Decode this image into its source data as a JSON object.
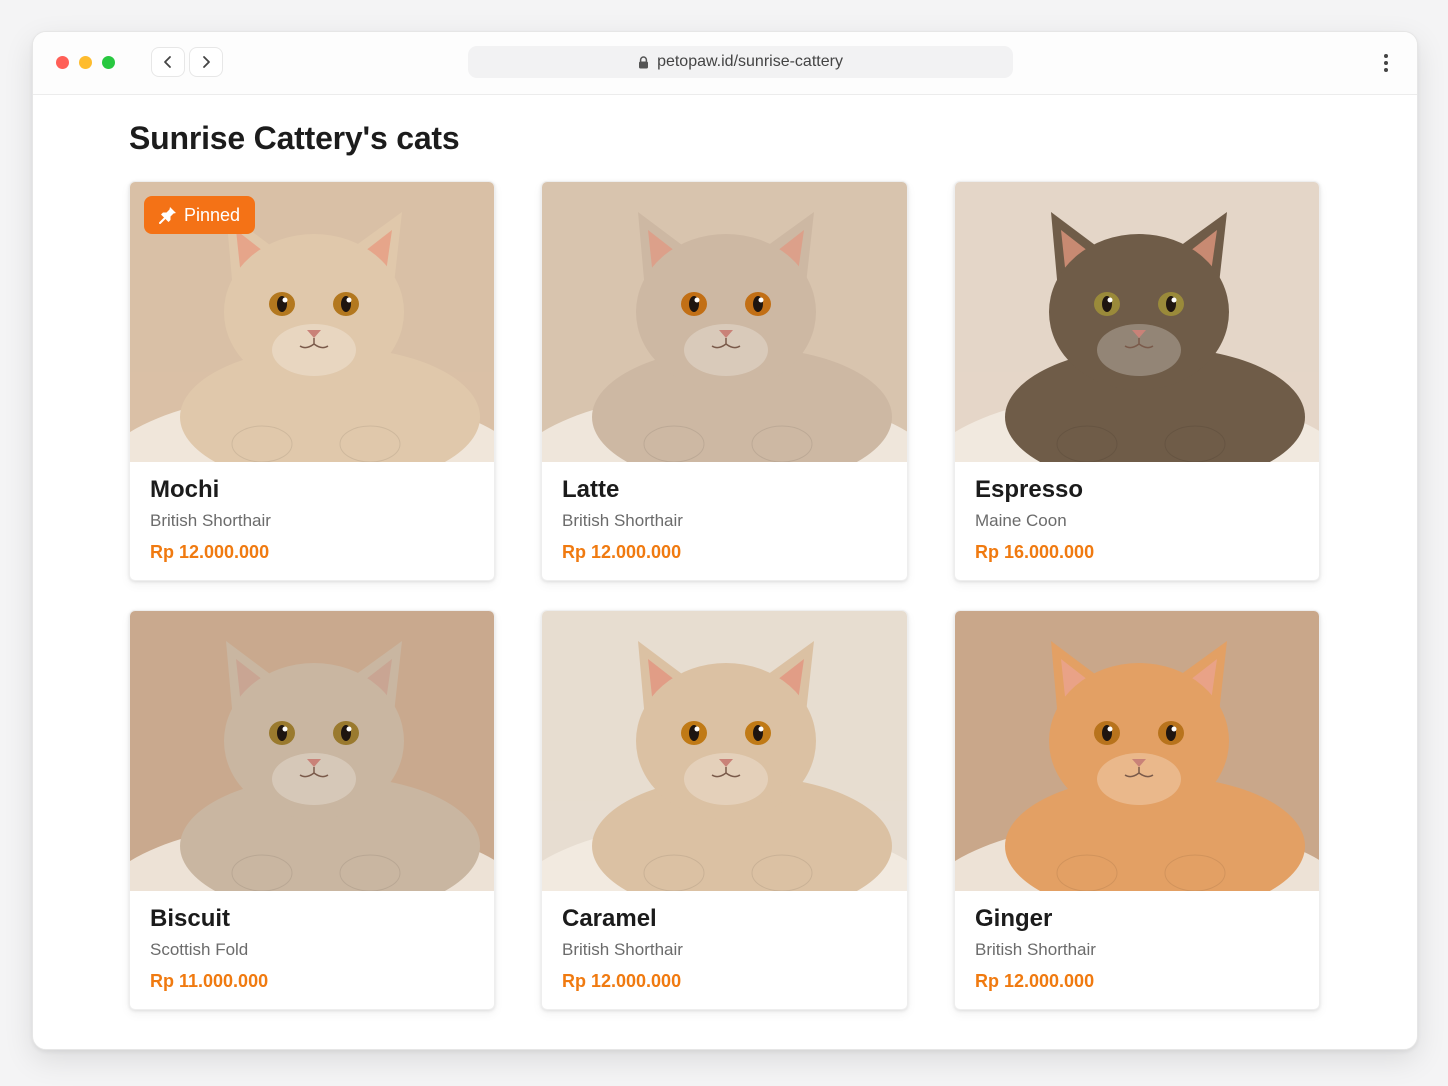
{
  "browser": {
    "url": "petopaw.id/sunrise-cattery",
    "icons": {
      "back": "chevron-left-icon",
      "forward": "chevron-right-icon",
      "lock": "lock-icon",
      "menu": "more-vertical-icon"
    }
  },
  "page": {
    "title": "Sunrise Cattery's cats"
  },
  "pinned_label": "Pinned",
  "cats": [
    {
      "name": "Mochi",
      "breed": "British Shorthair",
      "price": "Rp 12.000.000",
      "pinned": true,
      "fur": "#e0c8ab",
      "bg": "#d9c0a6",
      "ear": "#e6a58a",
      "eye": "#b3781f"
    },
    {
      "name": "Latte",
      "breed": "British Shorthair",
      "price": "Rp 12.000.000",
      "pinned": false,
      "fur": "#cdb8a3",
      "bg": "#d8c4ae",
      "ear": "#dca08a",
      "eye": "#c26f15"
    },
    {
      "name": "Espresso",
      "breed": "Maine Coon",
      "price": "Rp 16.000.000",
      "pinned": false,
      "fur": "#6f5c48",
      "bg": "#e4d6c8",
      "ear": "#c88a72",
      "eye": "#9a8a3a"
    },
    {
      "name": "Biscuit",
      "breed": "Scottish Fold",
      "price": "Rp 11.000.000",
      "pinned": false,
      "fur": "#c9b6a1",
      "bg": "#c9a98e",
      "ear": "#c9a593",
      "eye": "#9a7a2e"
    },
    {
      "name": "Caramel",
      "breed": "British Shorthair",
      "price": "Rp 12.000.000",
      "pinned": false,
      "fur": "#dbc1a3",
      "bg": "#e7ddd0",
      "ear": "#e19d86",
      "eye": "#c07a16"
    },
    {
      "name": "Ginger",
      "breed": "British Shorthair",
      "price": "Rp 12.000.000",
      "pinned": false,
      "fur": "#e3a064",
      "bg": "#c9a78a",
      "ear": "#e9a287",
      "eye": "#b8731c"
    }
  ],
  "colors": {
    "accent": "#f47216",
    "price": "#f07a10"
  }
}
